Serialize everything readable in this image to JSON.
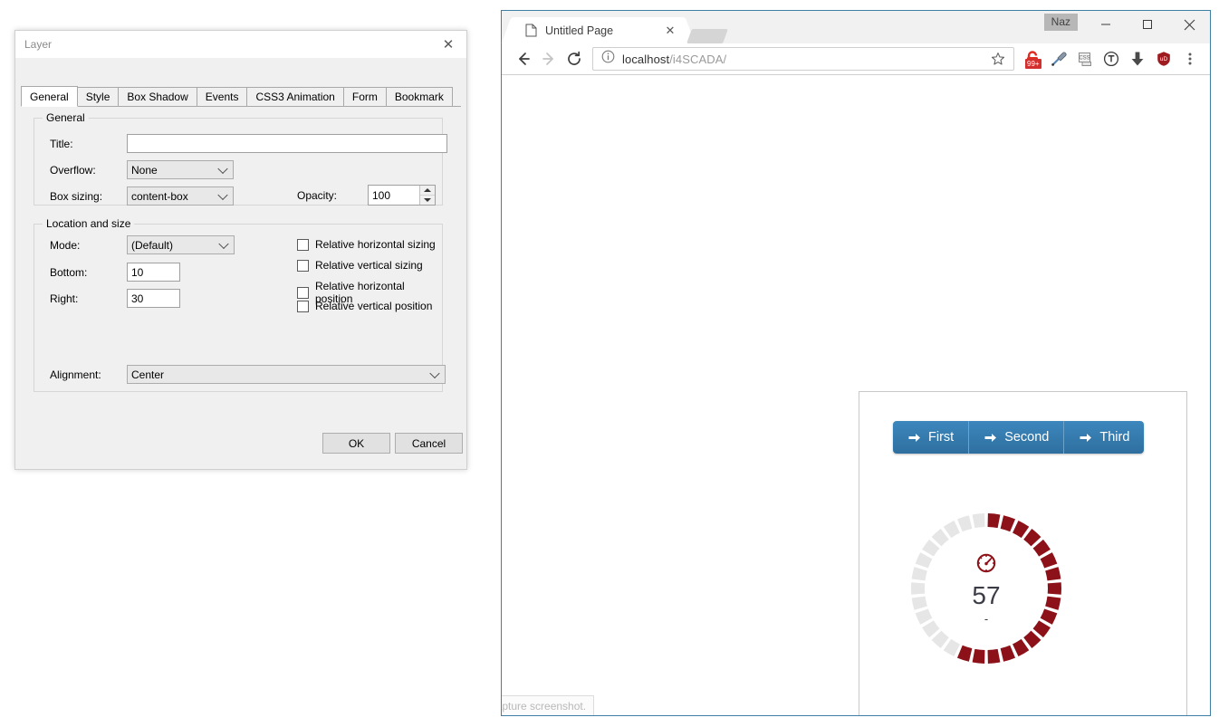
{
  "dialog": {
    "title": "Layer",
    "close_label": "✕",
    "tabs": [
      {
        "label": "General",
        "active": true
      },
      {
        "label": "Style",
        "active": false
      },
      {
        "label": "Box Shadow",
        "active": false
      },
      {
        "label": "Events",
        "active": false
      },
      {
        "label": "CSS3 Animation",
        "active": false
      },
      {
        "label": "Form",
        "active": false
      },
      {
        "label": "Bookmark",
        "active": false
      }
    ],
    "group_general": {
      "legend": "General",
      "title_label": "Title:",
      "title_value": "",
      "overflow_label": "Overflow:",
      "overflow_value": "None",
      "boxsizing_label": "Box sizing:",
      "boxsizing_value": "content-box",
      "opacity_label": "Opacity:",
      "opacity_value": "100"
    },
    "group_location": {
      "legend": "Location and size",
      "mode_label": "Mode:",
      "mode_value": "(Default)",
      "bottom_label": "Bottom:",
      "bottom_value": "10",
      "right_label": "Right:",
      "right_value": "30",
      "alignment_label": "Alignment:",
      "alignment_value": "Center",
      "checkboxes": [
        {
          "label": "Relative horizontal sizing",
          "checked": false
        },
        {
          "label": "Relative vertical sizing",
          "checked": false
        },
        {
          "label": "Relative horizontal position",
          "checked": false
        },
        {
          "label": "Relative vertical position",
          "checked": false
        }
      ]
    },
    "ok_label": "OK",
    "cancel_label": "Cancel"
  },
  "browser": {
    "tab": {
      "title": "Untitled Page",
      "close_label": "✕",
      "favicon": "page-icon"
    },
    "naz_chip": "Naz",
    "window_controls": {
      "minimize": "minimize-icon",
      "maximize": "maximize-icon",
      "close": "close-icon"
    },
    "toolbar": {
      "back": "back-arrow-icon",
      "forward": "forward-arrow-icon",
      "reload": "reload-icon",
      "info": "info-circle-icon",
      "url_host": "localhost",
      "url_path": "/i4SCADA/",
      "url_full": "localhost/i4SCADA/",
      "star": "star-icon",
      "extensions": [
        {
          "name": "lock-extension-icon",
          "badge": "99+"
        },
        {
          "name": "eyedropper-icon",
          "badge": ""
        },
        {
          "name": "css-extension-icon",
          "badge": ""
        },
        {
          "name": "tampermonkey-icon",
          "badge": ""
        },
        {
          "name": "download-icon",
          "badge": ""
        },
        {
          "name": "ublock-shield-icon",
          "badge": ""
        }
      ],
      "menu": "three-dot-menu-icon"
    },
    "statusbar_text": "Capture screenshot."
  },
  "page": {
    "nav_buttons": [
      {
        "label": "First",
        "icon": "arrow-right-icon"
      },
      {
        "label": "Second",
        "icon": "arrow-right-icon"
      },
      {
        "label": "Third",
        "icon": "arrow-right-icon"
      }
    ],
    "gauge": {
      "icon": "speedometer-icon",
      "value": "57",
      "unit": "-",
      "percent": 57,
      "segments": 30,
      "fill_color": "#8c1118",
      "track_color": "#e6e6e6"
    }
  },
  "colors": {
    "browser_border": "#3f7fa5",
    "button_blue": "#2f6f9f",
    "gauge_red": "#8c1118",
    "badge_red": "#d32f2f"
  }
}
